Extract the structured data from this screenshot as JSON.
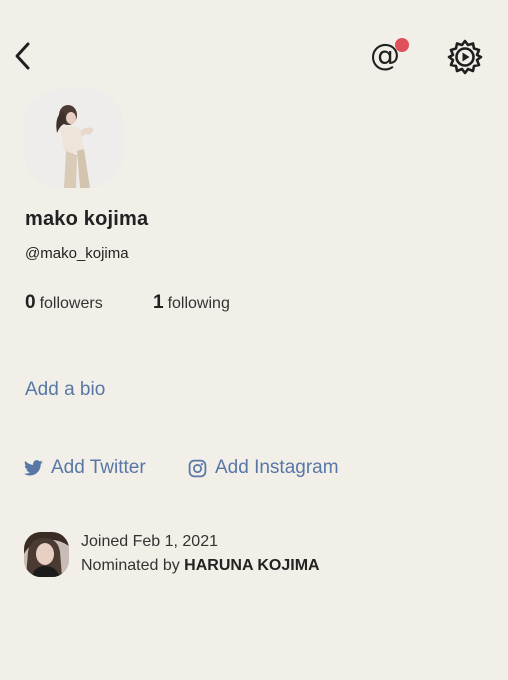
{
  "header": {
    "back_icon": "chevron-left-icon",
    "mention_icon": "at-sign-icon",
    "mention_glyph": "@",
    "notification_dot_color": "#e0505b",
    "settings_icon": "gear-icon"
  },
  "profile": {
    "name": "mako kojima",
    "handle": "@mako_kojima",
    "followers_count": "0",
    "followers_label": "followers",
    "following_count": "1",
    "following_label": "following",
    "add_bio_label": "Add a bio"
  },
  "social": {
    "twitter_label": "Add Twitter",
    "instagram_label": "Add Instagram",
    "link_color": "#5877a6"
  },
  "membership": {
    "joined_text": "Joined Feb 1, 2021",
    "nominated_prefix": "Nominated by",
    "nominator_name": "HARUNA KOJIMA"
  },
  "colors": {
    "background": "#f1efe8",
    "text": "#222222",
    "accent": "#5877a6"
  }
}
